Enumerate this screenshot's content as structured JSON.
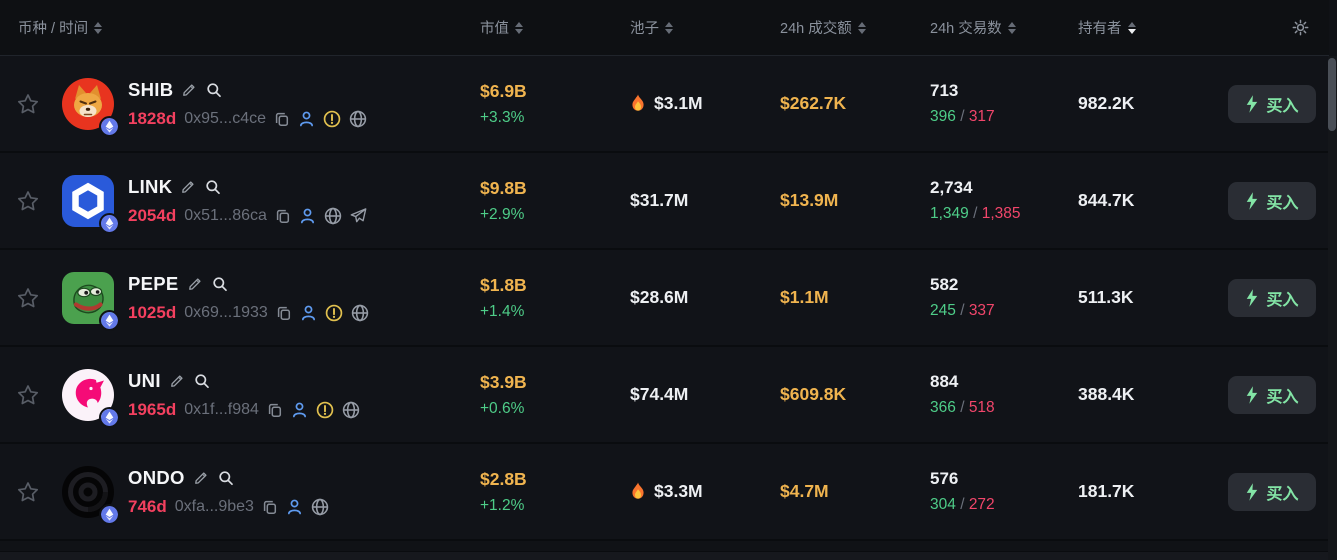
{
  "header": {
    "columns": [
      {
        "key": "token",
        "label": "币种 / 时间",
        "sort": "none"
      },
      {
        "key": "mcap",
        "label": "市值",
        "sort": "none"
      },
      {
        "key": "pool",
        "label": "池子",
        "sort": "none"
      },
      {
        "key": "volume",
        "label": "24h 成交额",
        "sort": "none"
      },
      {
        "key": "txns",
        "label": "24h 交易数",
        "sort": "none"
      },
      {
        "key": "holders",
        "label": "持有者",
        "sort": "desc"
      }
    ],
    "settings_icon": "gear-icon"
  },
  "buy_button_label": "买入",
  "colors": {
    "amber": "#f0b44f",
    "green": "#4ecd88",
    "red": "#f2466b",
    "age_pink": "#f3405f",
    "buy_green": "#83e5a6",
    "eth_badge_blue": "#6379e9"
  },
  "rows": [
    {
      "symbol": "SHIB",
      "age": "1828d",
      "address": "0x95...c4ce",
      "avatar": "shib",
      "chain": "eth",
      "icons": [
        "copy",
        "person",
        "alert",
        "globe"
      ],
      "mcap": "$6.9B",
      "change": "+3.3%",
      "pool": "$3.1M",
      "pool_fire": true,
      "volume": "$262.7K",
      "txn_total": "713",
      "txn_buys": "396",
      "txn_sells": "317",
      "holders": "982.2K"
    },
    {
      "symbol": "LINK",
      "age": "2054d",
      "address": "0x51...86ca",
      "avatar": "link",
      "chain": "eth",
      "icons": [
        "copy",
        "person",
        "globe",
        "telegram"
      ],
      "mcap": "$9.8B",
      "change": "+2.9%",
      "pool": "$31.7M",
      "pool_fire": false,
      "volume": "$13.9M",
      "txn_total": "2,734",
      "txn_buys": "1,349",
      "txn_sells": "1,385",
      "holders": "844.7K"
    },
    {
      "symbol": "PEPE",
      "age": "1025d",
      "address": "0x69...1933",
      "avatar": "pepe",
      "chain": "eth",
      "icons": [
        "copy",
        "person",
        "alert",
        "globe"
      ],
      "mcap": "$1.8B",
      "change": "+1.4%",
      "pool": "$28.6M",
      "pool_fire": false,
      "volume": "$1.1M",
      "txn_total": "582",
      "txn_buys": "245",
      "txn_sells": "337",
      "holders": "511.3K"
    },
    {
      "symbol": "UNI",
      "age": "1965d",
      "address": "0x1f...f984",
      "avatar": "uni",
      "chain": "eth",
      "icons": [
        "copy",
        "person",
        "alert",
        "globe"
      ],
      "mcap": "$3.9B",
      "change": "+0.6%",
      "pool": "$74.4M",
      "pool_fire": false,
      "volume": "$609.8K",
      "txn_total": "884",
      "txn_buys": "366",
      "txn_sells": "518",
      "holders": "388.4K"
    },
    {
      "symbol": "ONDO",
      "age": "746d",
      "address": "0xfa...9be3",
      "avatar": "ondo",
      "chain": "eth",
      "icons": [
        "copy",
        "person",
        "globe"
      ],
      "mcap": "$2.8B",
      "change": "+1.2%",
      "pool": "$3.3M",
      "pool_fire": true,
      "volume": "$4.7M",
      "txn_total": "576",
      "txn_buys": "304",
      "txn_sells": "272",
      "holders": "181.7K"
    }
  ]
}
